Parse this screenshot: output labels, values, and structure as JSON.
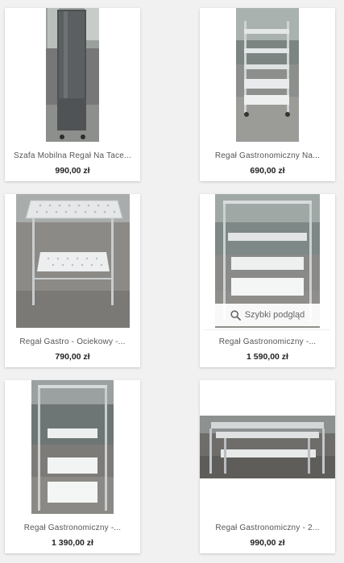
{
  "products": [
    {
      "title": "Szafa Mobilna Regał Na Tace...",
      "price": "990,00 zł"
    },
    {
      "title": "Regał Gastronomiczny Na...",
      "price": "690,00 zł"
    },
    {
      "title": "Regał Gastro - Ociekowy -...",
      "price": "790,00 zł"
    },
    {
      "title": "Regał Gastronomiczny -...",
      "price": "1 590,00 zł"
    },
    {
      "title": "Regał Gastronomiczny -...",
      "price": "1 390,00 zł"
    },
    {
      "title": "Regał Gastronomiczny - 2...",
      "price": "990,00 zł"
    }
  ],
  "quick_view": {
    "label": "Szybki podgląd",
    "icon": "search-icon"
  },
  "colors": {
    "price": "#222222",
    "title": "#555555",
    "background": "#f1f1f1"
  }
}
